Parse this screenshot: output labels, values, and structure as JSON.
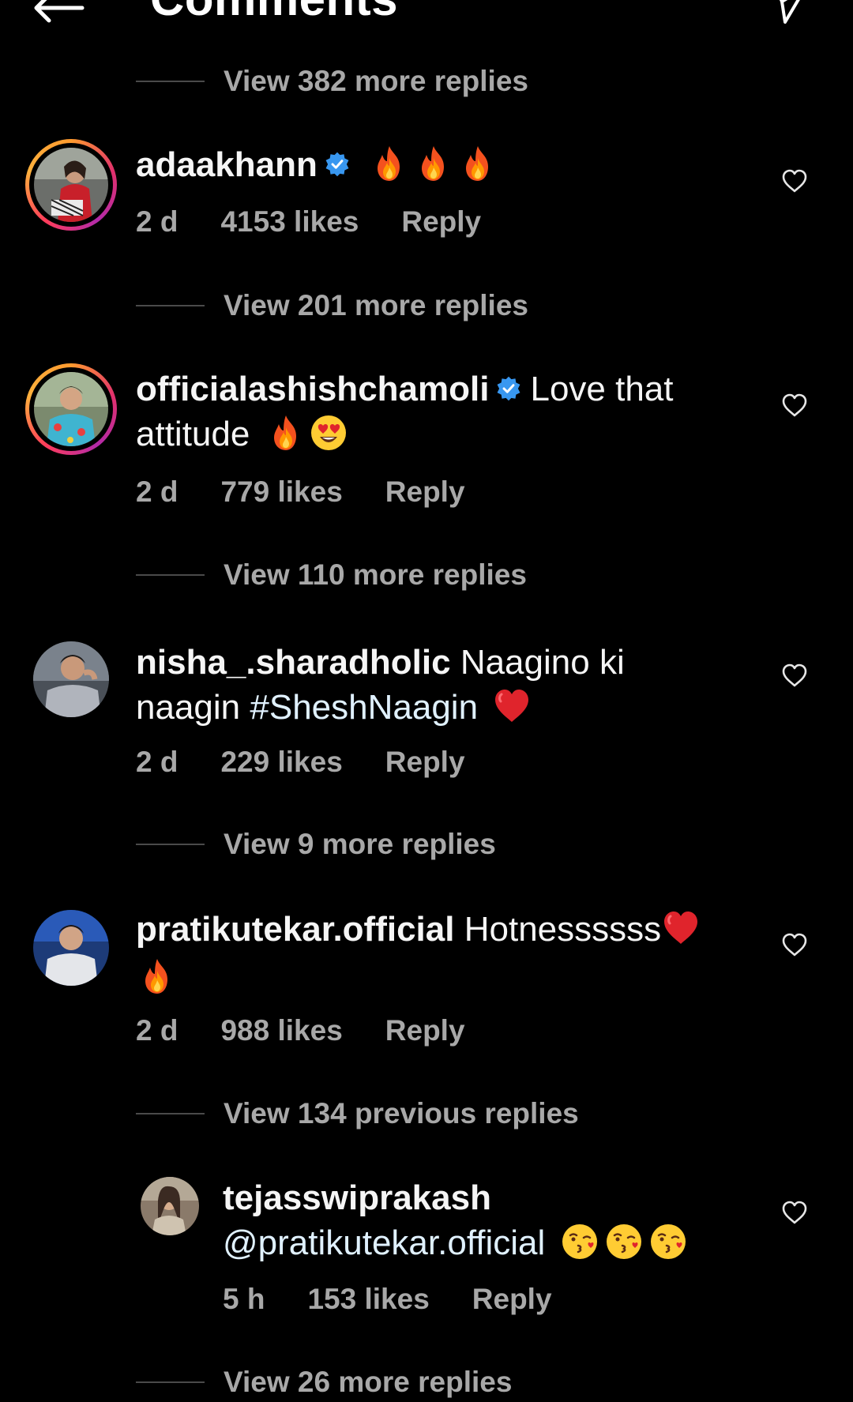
{
  "header": {
    "title": "Comments"
  },
  "view_more": [
    {
      "text": "View 382 more replies"
    },
    {
      "text": "View 201 more replies"
    },
    {
      "text": "View 110 more replies"
    },
    {
      "text": "View 9 more replies"
    },
    {
      "text": "View 134 previous replies"
    },
    {
      "text": "View 26 more replies"
    }
  ],
  "comments": [
    {
      "username": "adaakhann",
      "verified": true,
      "text": "",
      "emoji": [
        "fire",
        "fire",
        "fire"
      ],
      "time": "2 d",
      "likes": "4153 likes",
      "reply": "Reply"
    },
    {
      "username": "officialashishchamoli",
      "verified": true,
      "text_line1": "Love that",
      "text_line2": "attitude",
      "emoji": [
        "fire",
        "heart-eyes"
      ],
      "time": "2 d",
      "likes": "779 likes",
      "reply": "Reply"
    },
    {
      "username": "nisha_.sharadholic",
      "verified": false,
      "text_line1": "Naagino ki",
      "text_line2_prefix": "naagin",
      "hashtag": "#SheshNaagin",
      "emoji": [
        "red-heart"
      ],
      "time": "2 d",
      "likes": "229 likes",
      "reply": "Reply"
    },
    {
      "username": "pratikutekar.official",
      "verified": false,
      "text_line1": "Hotnessssss",
      "emoji": [
        "red-heart",
        "fire"
      ],
      "time": "2 d",
      "likes": "988 likes",
      "reply": "Reply"
    },
    {
      "username": "tejasswiprakash",
      "verified": false,
      "mention": "@pratikutekar.official",
      "emoji": [
        "kissing",
        "kissing",
        "kissing"
      ],
      "time": "5 h",
      "likes": "153 likes",
      "reply": "Reply"
    }
  ],
  "colors": {
    "background": "#000000",
    "text": "#f5f5f5",
    "muted": "#a8a8a8",
    "verified": "#3897f0"
  }
}
